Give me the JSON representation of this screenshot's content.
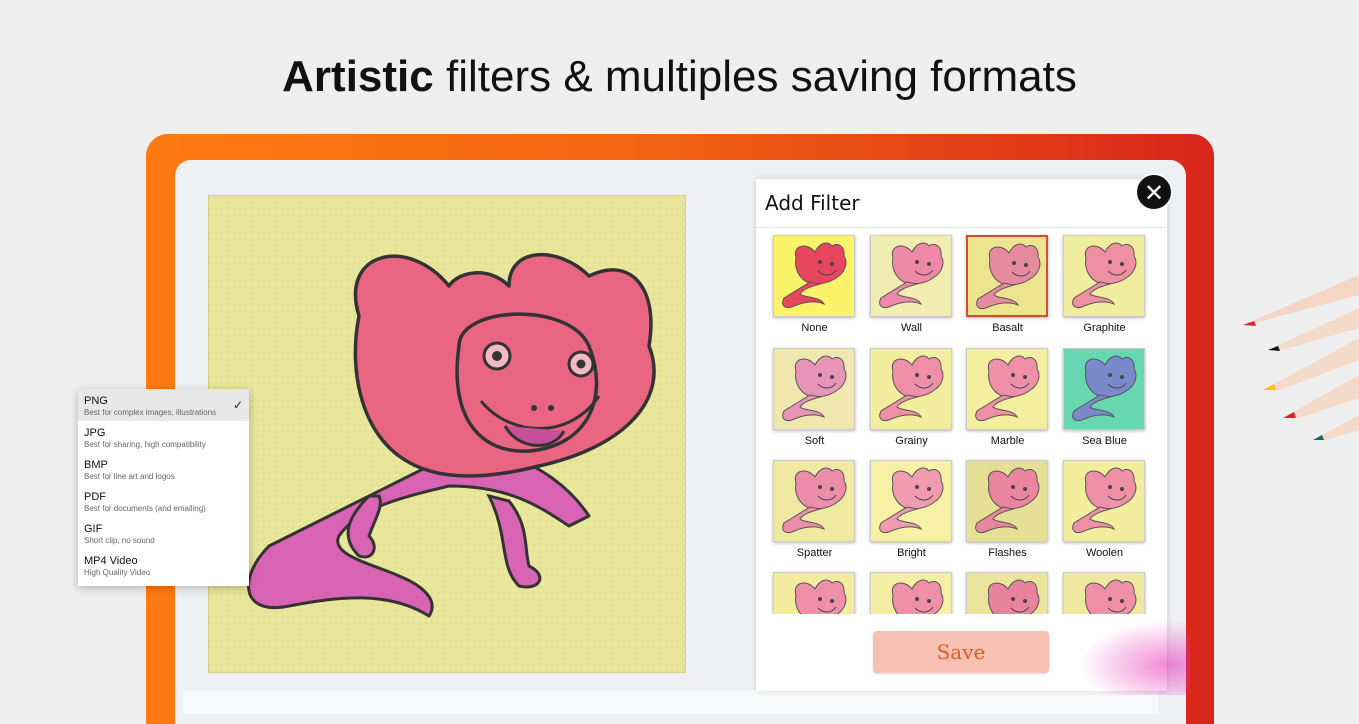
{
  "headline": {
    "bold": "Artistic",
    "rest": " filters & multiples saving formats"
  },
  "format_menu": {
    "items": [
      {
        "name": "PNG",
        "desc": "Best for complex images, illustrations",
        "selected": true
      },
      {
        "name": "JPG",
        "desc": "Best for sharing, high compatibility",
        "selected": false
      },
      {
        "name": "BMP",
        "desc": "Best for line art and logos",
        "selected": false
      },
      {
        "name": "PDF",
        "desc": "Best for documents (and emailing)",
        "selected": false
      },
      {
        "name": "GIF",
        "desc": "Short clip, no sound",
        "selected": false
      },
      {
        "name": "MP4 Video",
        "desc": "High Quality Video",
        "selected": false
      }
    ],
    "check_glyph": "✓"
  },
  "filter_panel": {
    "title": "Add Filter",
    "filters": [
      {
        "label": "None",
        "bg": "#fbf46a",
        "fill": "#e8455e",
        "selected": false
      },
      {
        "label": "Wall",
        "bg": "#f1ecb0",
        "fill": "#ee8aa8",
        "selected": false
      },
      {
        "label": "Basalt",
        "bg": "#ece48f",
        "fill": "#e78aa0",
        "selected": true
      },
      {
        "label": "Graphite",
        "bg": "#f1ed9f",
        "fill": "#ef8fa2",
        "selected": false
      },
      {
        "label": "Soft",
        "bg": "#efe7ad",
        "fill": "#e894b6",
        "selected": false
      },
      {
        "label": "Grainy",
        "bg": "#f3ee9d",
        "fill": "#ef8fa8",
        "selected": false
      },
      {
        "label": "Marble",
        "bg": "#f4ee9f",
        "fill": "#ef8fa8",
        "selected": false
      },
      {
        "label": "Sea Blue",
        "bg": "#67d7b2",
        "fill": "#7a89c9",
        "selected": false
      },
      {
        "label": "Spatter",
        "bg": "#efe9a2",
        "fill": "#ec8eab",
        "selected": false
      },
      {
        "label": "Bright",
        "bg": "#f6f1a4",
        "fill": "#f09bb0",
        "selected": false
      },
      {
        "label": "Flashes",
        "bg": "#e6df96",
        "fill": "#e9859e",
        "selected": false
      },
      {
        "label": "Woolen",
        "bg": "#f3ed9e",
        "fill": "#ef90a6",
        "selected": false
      },
      {
        "label": "",
        "bg": "#f1ec9e",
        "fill": "#ef8fa8",
        "selected": false
      },
      {
        "label": "",
        "bg": "#f4efa4",
        "fill": "#ef8fa8",
        "selected": false
      },
      {
        "label": "",
        "bg": "#ebe49c",
        "fill": "#e8839e",
        "selected": false
      },
      {
        "label": "",
        "bg": "#efe99f",
        "fill": "#ef8fa8",
        "selected": false
      }
    ]
  },
  "save_label": "Save",
  "close_glyph": "✕",
  "colors": {
    "frame_start": "#ff7a12",
    "frame_end": "#d8251b",
    "save_bg": "#f6c1b3",
    "save_text": "#e05a2c",
    "selected_border": "#d94b2a",
    "canvas_bg": "#e9e59b",
    "lizard_head": "#e96582",
    "lizard_body": "#d964b4"
  },
  "icons": {
    "close": "close-icon",
    "check": "check-icon"
  }
}
